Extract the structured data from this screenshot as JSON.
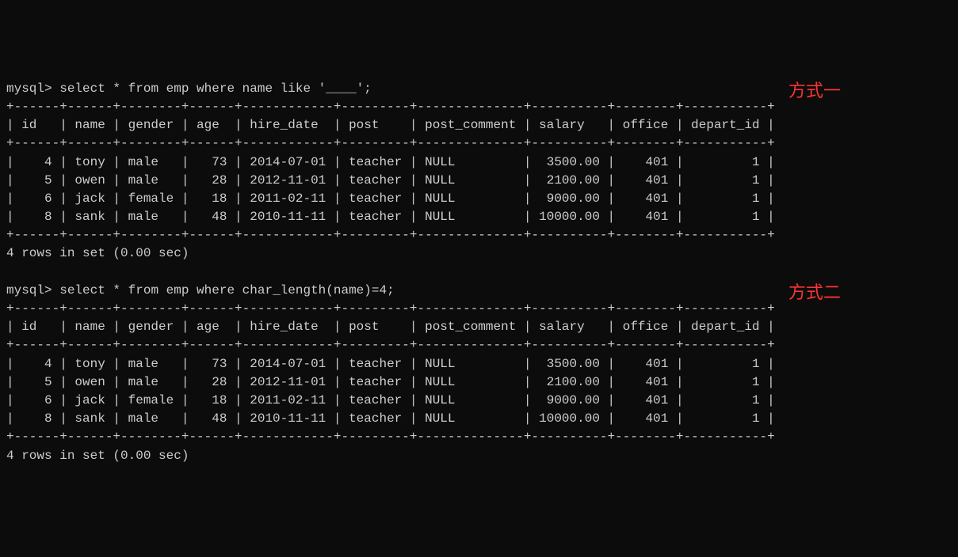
{
  "query1": {
    "prompt": "mysql> ",
    "sql": "select * from emp where name like '____';",
    "annotation": "方式一",
    "border_top": "+------+------+--------+------+------------+---------+--------------+----------+--------+-----------+",
    "header": "| id   | name | gender | age  | hire_date  | post    | post_comment | salary   | office | depart_id |",
    "border_mid": "+------+------+--------+------+------------+---------+--------------+----------+--------+-----------+",
    "rows": [
      "|    4 | tony | male   |   73 | 2014-07-01 | teacher | NULL         |  3500.00 |    401 |         1 |",
      "|    5 | owen | male   |   28 | 2012-11-01 | teacher | NULL         |  2100.00 |    401 |         1 |",
      "|    6 | jack | female |   18 | 2011-02-11 | teacher | NULL         |  9000.00 |    401 |         1 |",
      "|    8 | sank | male   |   48 | 2010-11-11 | teacher | NULL         | 10000.00 |    401 |         1 |"
    ],
    "border_bot": "+------+------+--------+------+------------+---------+--------------+----------+--------+-----------+",
    "result_msg": "4 rows in set (0.00 sec)"
  },
  "query2": {
    "prompt": "mysql> ",
    "sql": "select * from emp where char_length(name)=4;",
    "annotation": "方式二",
    "border_top": "+------+------+--------+------+------------+---------+--------------+----------+--------+-----------+",
    "header": "| id   | name | gender | age  | hire_date  | post    | post_comment | salary   | office | depart_id |",
    "border_mid": "+------+------+--------+------+------------+---------+--------------+----------+--------+-----------+",
    "rows": [
      "|    4 | tony | male   |   73 | 2014-07-01 | teacher | NULL         |  3500.00 |    401 |         1 |",
      "|    5 | owen | male   |   28 | 2012-11-01 | teacher | NULL         |  2100.00 |    401 |         1 |",
      "|    6 | jack | female |   18 | 2011-02-11 | teacher | NULL         |  9000.00 |    401 |         1 |",
      "|    8 | sank | male   |   48 | 2010-11-11 | teacher | NULL         | 10000.00 |    401 |         1 |"
    ],
    "border_bot": "+------+------+--------+------+------------+---------+--------------+----------+--------+-----------+",
    "result_msg": "4 rows in set (0.00 sec)"
  },
  "chart_data": {
    "type": "table",
    "title": "emp table results (queries filtering names of length 4)",
    "columns": [
      "id",
      "name",
      "gender",
      "age",
      "hire_date",
      "post",
      "post_comment",
      "salary",
      "office",
      "depart_id"
    ],
    "rows": [
      [
        4,
        "tony",
        "male",
        73,
        "2014-07-01",
        "teacher",
        null,
        3500.0,
        401,
        1
      ],
      [
        5,
        "owen",
        "male",
        28,
        "2012-11-01",
        "teacher",
        null,
        2100.0,
        401,
        1
      ],
      [
        6,
        "jack",
        "female",
        18,
        "2011-02-11",
        "teacher",
        null,
        9000.0,
        401,
        1
      ],
      [
        8,
        "sank",
        "male",
        48,
        "2010-11-11",
        "teacher",
        null,
        10000.0,
        401,
        1
      ]
    ]
  }
}
